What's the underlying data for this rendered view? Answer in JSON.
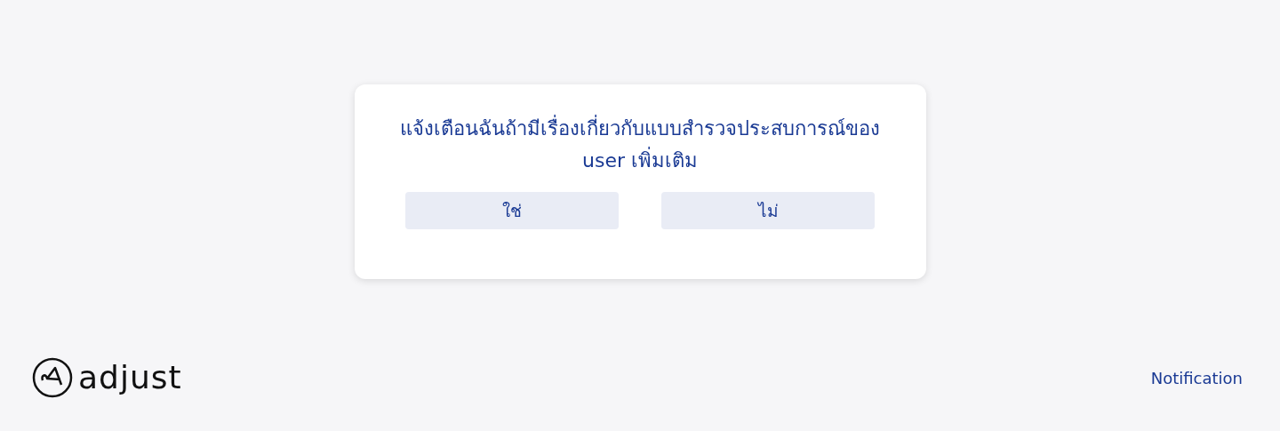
{
  "dialog": {
    "question": "แจ้งเตือนฉันถ้ามีเรื่องเกี่ยวกับแบบสำรวจประสบการณ์ของ user เพิ่มเติม",
    "buttons": [
      {
        "label": "ใช่"
      },
      {
        "label": "ไม่"
      }
    ]
  },
  "footer": {
    "logo": "adjust",
    "link": "Notification"
  }
}
